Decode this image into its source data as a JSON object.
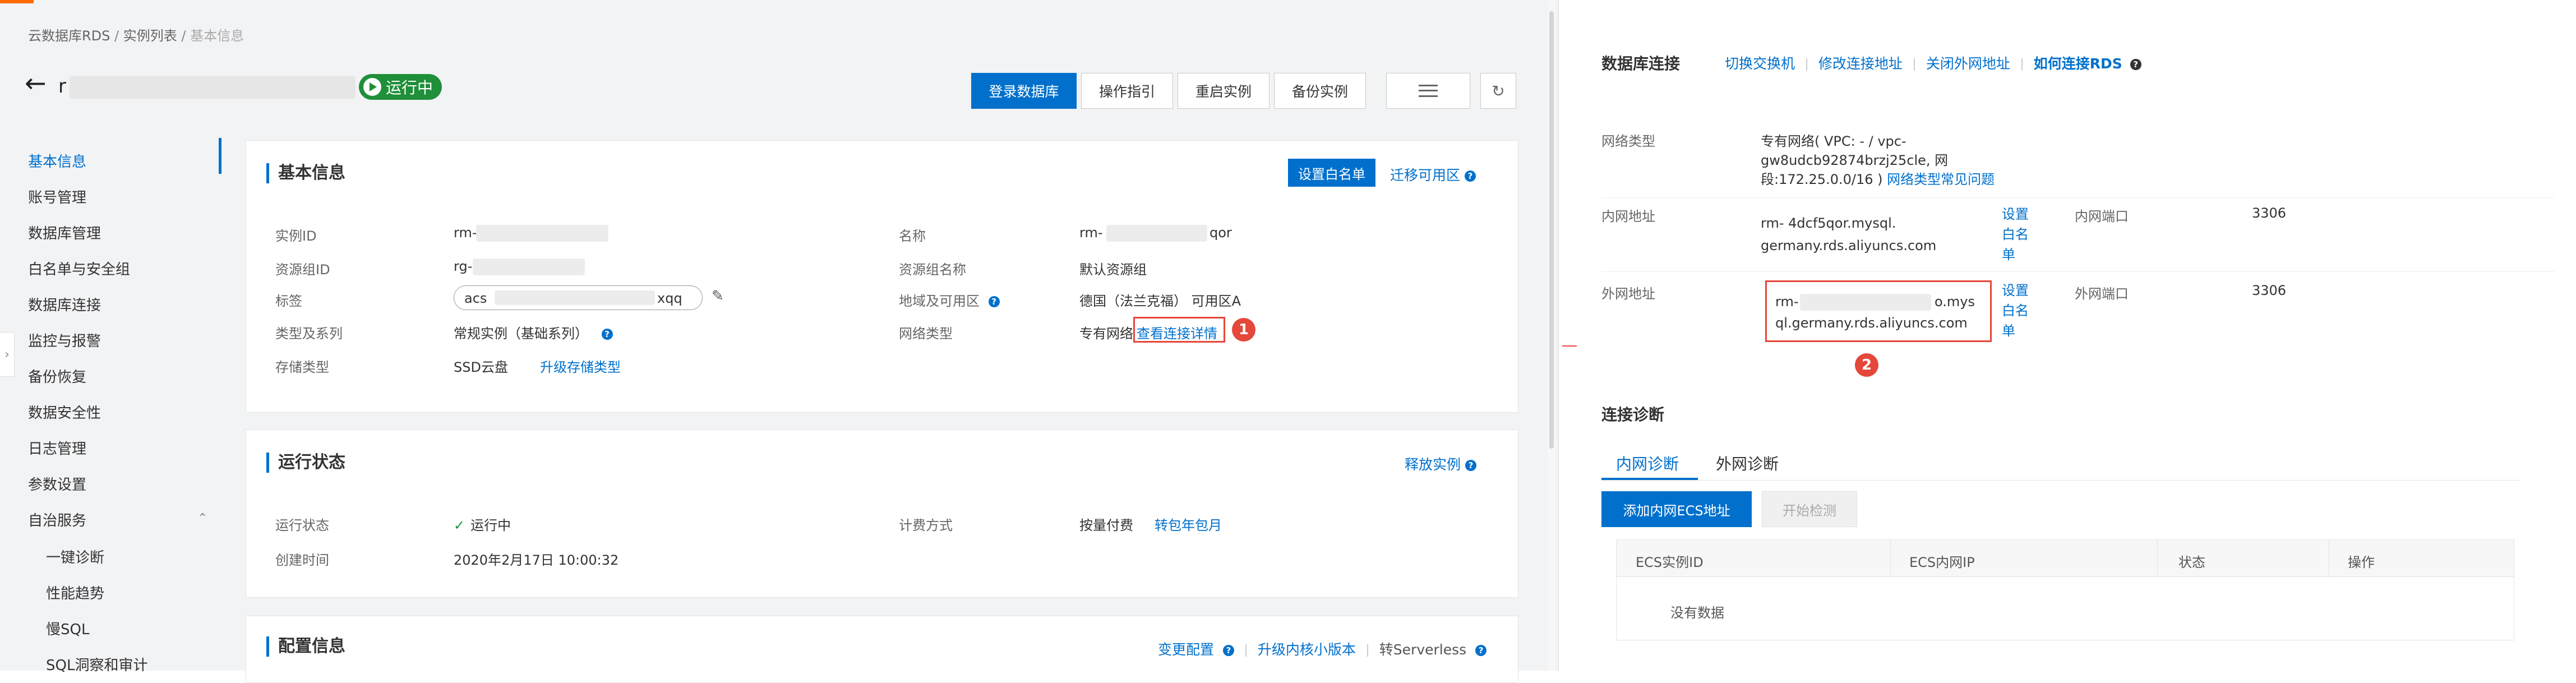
{
  "left_panel": {
    "breadcrumb": [
      "云数据库RDS",
      "实例列表",
      "基本信息"
    ],
    "instance_title_prefix": "r",
    "status": "运行中",
    "toolbar": {
      "login": "登录数据库",
      "guide": "操作指引",
      "restart": "重启实例",
      "backup": "备份实例"
    },
    "sidebar": {
      "items": [
        "基本信息",
        "账号管理",
        "数据库管理",
        "白名单与安全组",
        "数据库连接",
        "监控与报警",
        "备份恢复",
        "数据安全性",
        "日志管理",
        "参数设置",
        "自治服务"
      ],
      "sub_items": [
        "一键诊断",
        "性能趋势",
        "慢SQL",
        "SQL洞察和审计"
      ]
    },
    "basic_info": {
      "title": "基本信息",
      "set_whitelist": "设置白名单",
      "migrate_zone": "迁移可用区",
      "instance_id_label": "实例ID",
      "instance_id_value": "rm-",
      "rg_id_label": "资源组ID",
      "rg_id_value": "rg-",
      "tags_label": "标签",
      "tags_value_prefix": "acs",
      "tags_value_suffix": "xqq",
      "type_label": "类型及系列",
      "type_value": "常规实例（基础系列）",
      "storage_label": "存储类型",
      "storage_value": "SSD云盘",
      "upgrade_storage": "升级存储类型",
      "name_label": "名称",
      "name_value_prefix": "rm-",
      "name_value_suffix": "qor",
      "rg_name_label": "资源组名称",
      "rg_name_value": "默认资源组",
      "region_label": "地域及可用区",
      "region_value": "德国（法兰克福） 可用区A",
      "net_label": "网络类型",
      "net_value": "专有网络",
      "view_conn": "查看连接详情",
      "marker": "1"
    },
    "run_status": {
      "title": "运行状态",
      "release": "释放实例",
      "status_label": "运行状态",
      "status_value": "运行中",
      "created_label": "创建时间",
      "created_value": "2020年2月17日 10:00:32",
      "billing_label": "计费方式",
      "billing_value": "按量付费",
      "to_monthly": "转包年包月"
    },
    "config": {
      "title": "配置信息",
      "change_config": "变更配置",
      "upgrade_minor": "升级内核小版本",
      "serverless": "转Serverless"
    }
  },
  "right_panel": {
    "title": "数据库连接",
    "links": [
      "切换交换机",
      "修改连接地址",
      "关闭外网地址",
      "如何连接RDS"
    ],
    "net_type_label": "网络类型",
    "net_type_line1": "专有网络( VPC: - / vpc-",
    "net_type_line2": "gw8udcb92874brzj25cle, 网",
    "net_type_line3_prefix": "段:172.25.0.0/16 )",
    "net_type_faq": "网络类型常见问题",
    "internal_label": "内网地址",
    "internal_line1": "rm-             4dcf5qor.mysql.",
    "internal_line2": "germany.rds.aliyuncs.com",
    "set_whitelist_a": "设置",
    "set_whitelist_b": "白名",
    "set_whitelist_c": "单",
    "internal_port_label": "内网端口",
    "internal_port": "3306",
    "external_label": "外网地址",
    "external_line1_prefix": "rm-",
    "external_line1_suffix": "o.mys",
    "external_line2": "ql.germany.rds.aliyuncs.com",
    "external_port_label": "外网端口",
    "external_port": "3306",
    "marker": "2",
    "diag_title": "连接诊断",
    "tabs": [
      "内网诊断",
      "外网诊断"
    ],
    "add_ecs": "添加内网ECS地址",
    "start_check": "开始检测",
    "table_headers": [
      "ECS实例ID",
      "ECS内网IP",
      "状态",
      "操作"
    ],
    "empty": "没有数据"
  },
  "colors": {
    "accent": "#0070cc",
    "status_green": "#1f8f3a",
    "marker_red": "#e5473a"
  }
}
